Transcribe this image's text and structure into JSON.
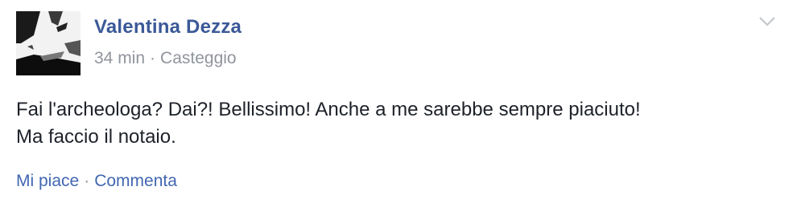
{
  "post": {
    "author": "Valentina Dezza",
    "time": "34 min",
    "separator": "·",
    "location": "Casteggio",
    "text_lines": [
      "Fai l'archeologa? Dai?! Bellissimo! Anche a me sarebbe sempre piaciuto!",
      "Ma faccio il notaio."
    ],
    "menu_icon": "chevron-down-icon"
  },
  "actions": {
    "like_label": "Mi piace",
    "separator": "·",
    "comment_label": "Commenta"
  },
  "colors": {
    "author": "#3b5998",
    "meta": "#90949c",
    "body": "#1d2129",
    "action_link": "#4267b2"
  }
}
